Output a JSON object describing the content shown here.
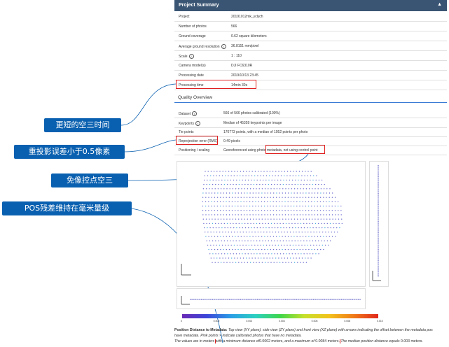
{
  "project_summary": {
    "title": "Project Summary",
    "collapse_icon": "triangle-up-icon",
    "rows": [
      {
        "label": "Project",
        "value": "20191012mk_yclych"
      },
      {
        "label": "Number of photos",
        "value": "566"
      },
      {
        "label": "Ground coverage",
        "value": "0.62 square kilometers"
      },
      {
        "label": "Average ground resolution",
        "value": "36.8151 mm/pixel"
      },
      {
        "label": "Scale",
        "value": "1 : 110"
      },
      {
        "label": "Camera model(s)",
        "value": "DJI FC6310R"
      },
      {
        "label": "Processing date",
        "value": "2019/10/13 23:45"
      },
      {
        "label": "Processing time",
        "value": "14min 30s"
      }
    ]
  },
  "quality_overview": {
    "title": "Quality Overview",
    "rows": [
      {
        "label": "Dataset",
        "value": "566 of 566 photos calibrated (100%)"
      },
      {
        "label": "Keypoints",
        "value": "Median of 45359 keypoints per image"
      },
      {
        "label": "Tie points",
        "value": "170773 points, with a median of 1952 points per photo"
      },
      {
        "label": "Reprojection error (RMS)",
        "value": "0.49 pixels"
      },
      {
        "label": "Positioning / scaling",
        "value": "Georeferenced using photo metadata,",
        "value_highlight": "not using control point"
      }
    ]
  },
  "annotations": [
    {
      "text": "更短的空三时间"
    },
    {
      "text": "重投影误差小于0.5像素"
    },
    {
      "text": "免像控点空三"
    },
    {
      "text": "POS残差维持在毫米量级"
    }
  ],
  "colorbar": {
    "ticks": [
      "0",
      "0.002",
      "0.003",
      "0.004",
      "0.006",
      "0.008",
      "0.010"
    ]
  },
  "caption": {
    "heading": "Position Distance to Metadata:",
    "line1": "Top view (XY plane), side view (ZY plane) and front view (XZ plane) with arrows indicating the offset between the metadata pos",
    "line2": "have metadata. Pink points × indicate calibrated photos that have no metadata.",
    "line3_a": "The values are in meters",
    "line3_b": "with a minimum distance of",
    "min_value": "0.0002 meters",
    "line3_c": "and a maximum of",
    "max_value": "0.0084 meters.",
    "line3_d": "The median position distance equals",
    "median_value": "0.003 meters."
  },
  "colors": {
    "header_bg": "#3a5573",
    "callout_bg": "#0a60b0",
    "highlight_border": "#e02020",
    "accent_line": "#3a7bd5"
  }
}
